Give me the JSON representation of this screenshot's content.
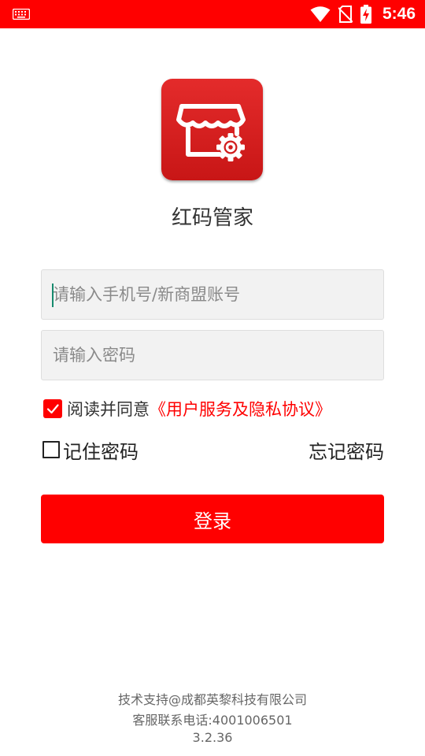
{
  "status_bar": {
    "time": "5:46",
    "background_color": "#ff0000",
    "icons": [
      "keyboard-icon",
      "wifi-icon",
      "no-sim-icon",
      "battery-charging-icon"
    ]
  },
  "app": {
    "name": "红码管家",
    "logo_icon": "storefront-gear-icon",
    "brand_color": "#ff0000"
  },
  "form": {
    "phone_placeholder": "请输入手机号/新商盟账号",
    "password_placeholder": "请输入密码",
    "agree_checked": true,
    "agree_text": "阅读并同意",
    "agree_link": "《用户服务及隐私协议》",
    "remember_checked": false,
    "remember_label": "记住密码",
    "forgot_label": "忘记密码",
    "login_label": "登录"
  },
  "footer": {
    "support": "技术支持@成都英黎科技有限公司",
    "hotline": "客服联系电话:4001006501",
    "version": "3.2.36"
  }
}
